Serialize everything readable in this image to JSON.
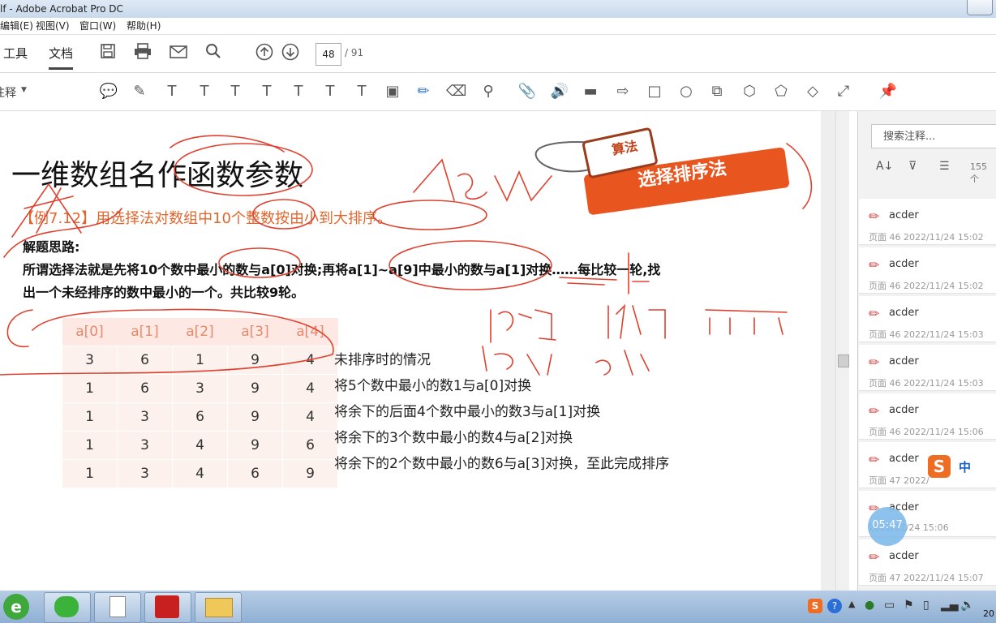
{
  "window": {
    "title": "lf - Adobe Acrobat Pro DC"
  },
  "menu": [
    "编辑(E)",
    "视图(V)",
    "窗口(W)",
    "帮助(H)"
  ],
  "tabs": [
    "工具",
    "文档"
  ],
  "page": {
    "current": "48",
    "total": "/ 91"
  },
  "annot_label": "注释",
  "document": {
    "title": "一维数组名作函数参数",
    "badge_small": "算法",
    "badge_big": "选择排序法",
    "example": "【例7.12】用选择法对数组中10个整数按由小到大排序。",
    "hint_label": "解题思路:",
    "hint_line1": "所谓选择法就是先将10个数中最小的数与a[0]对换;再将a[1]~a[9]中最小的数与a[1]对换……每比较一轮,找",
    "hint_line2": "出一个未经排序的数中最小的一个。共比较9轮。",
    "headers": [
      "a[0]",
      "a[1]",
      "a[2]",
      "a[3]",
      "a[4]"
    ],
    "rows": [
      [
        "3",
        "6",
        "1",
        "9",
        "4"
      ],
      [
        "1",
        "6",
        "3",
        "9",
        "4"
      ],
      [
        "1",
        "3",
        "6",
        "9",
        "4"
      ],
      [
        "1",
        "3",
        "4",
        "9",
        "6"
      ],
      [
        "1",
        "3",
        "4",
        "6",
        "9"
      ]
    ],
    "descriptions": [
      "未排序时的情况",
      "将5个数中最小的数1与a[0]对换",
      "将余下的后面4个数中最小的数3与a[1]对换",
      "将余下的3个数中最小的数4与a[2]对换",
      "将余下的2个数中最小的数6与a[3]对换，至此完成排序"
    ]
  },
  "comments_panel": {
    "search_placeholder": "搜索注释...",
    "count": "155 个",
    "items": [
      {
        "author": "acder",
        "meta": "页面 46  2022/11/24 15:02"
      },
      {
        "author": "acder",
        "meta": "页面 46  2022/11/24 15:02"
      },
      {
        "author": "acder",
        "meta": "页面 46  2022/11/24 15:03"
      },
      {
        "author": "acder",
        "meta": "页面 46  2022/11/24 15:03"
      },
      {
        "author": "acder",
        "meta": "页面 46  2022/11/24 15:06"
      },
      {
        "author": "acder",
        "meta": "页面 47  2022/"
      },
      {
        "author": "acder",
        "meta": "2022/11/24 15:06"
      },
      {
        "author": "acder",
        "meta": "页面 47  2022/11/24 15:07"
      }
    ]
  },
  "overlay": {
    "timer": "05:47",
    "ime": "中"
  },
  "taskbar": {
    "clock": "20"
  }
}
